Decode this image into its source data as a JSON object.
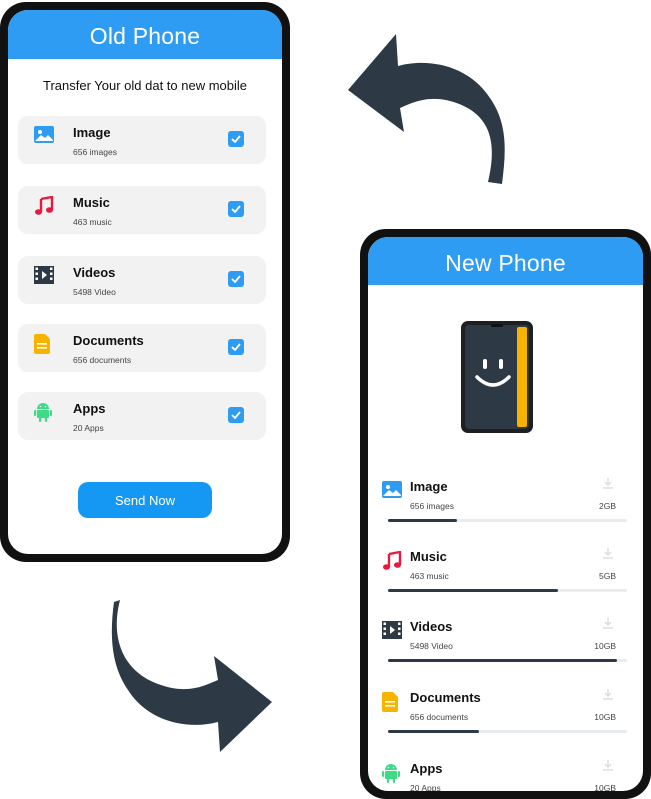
{
  "old_phone": {
    "title": "Old Phone",
    "subtitle": "Transfer Your old dat to new mobile",
    "items": [
      {
        "title": "Image",
        "sub": "656 images",
        "icon": "image-icon",
        "checked": true
      },
      {
        "title": "Music",
        "sub": "463 music",
        "icon": "music-icon",
        "checked": true
      },
      {
        "title": "Videos",
        "sub": "5498 Video",
        "icon": "video-icon",
        "checked": true
      },
      {
        "title": "Documents",
        "sub": "656 documents",
        "icon": "document-icon",
        "checked": true
      },
      {
        "title": "Apps",
        "sub": "20 Apps",
        "icon": "android-icon",
        "checked": true
      }
    ],
    "send_label": "Send Now"
  },
  "new_phone": {
    "title": "New Phone",
    "items": [
      {
        "title": "Image",
        "sub": "656 images",
        "size": "2GB",
        "progress": 0.29,
        "icon": "image-icon"
      },
      {
        "title": "Music",
        "sub": "463 music",
        "size": "5GB",
        "progress": 0.71,
        "icon": "music-icon"
      },
      {
        "title": "Videos",
        "sub": "5498 Video",
        "size": "10GB",
        "progress": 0.96,
        "icon": "video-icon"
      },
      {
        "title": "Documents",
        "sub": "656 documents",
        "size": "10GB",
        "progress": 0.38,
        "icon": "document-icon"
      },
      {
        "title": "Apps",
        "sub": "20 Apps",
        "size": "10GB",
        "progress": 0.1,
        "icon": "android-icon"
      }
    ]
  },
  "colors": {
    "accent": "#2f9cf4",
    "button": "#1598f4",
    "arrow": "#2d3a46",
    "progress": "#2d3a46",
    "music": "#e8193c",
    "document": "#f6b400",
    "android": "#3ddc84"
  }
}
